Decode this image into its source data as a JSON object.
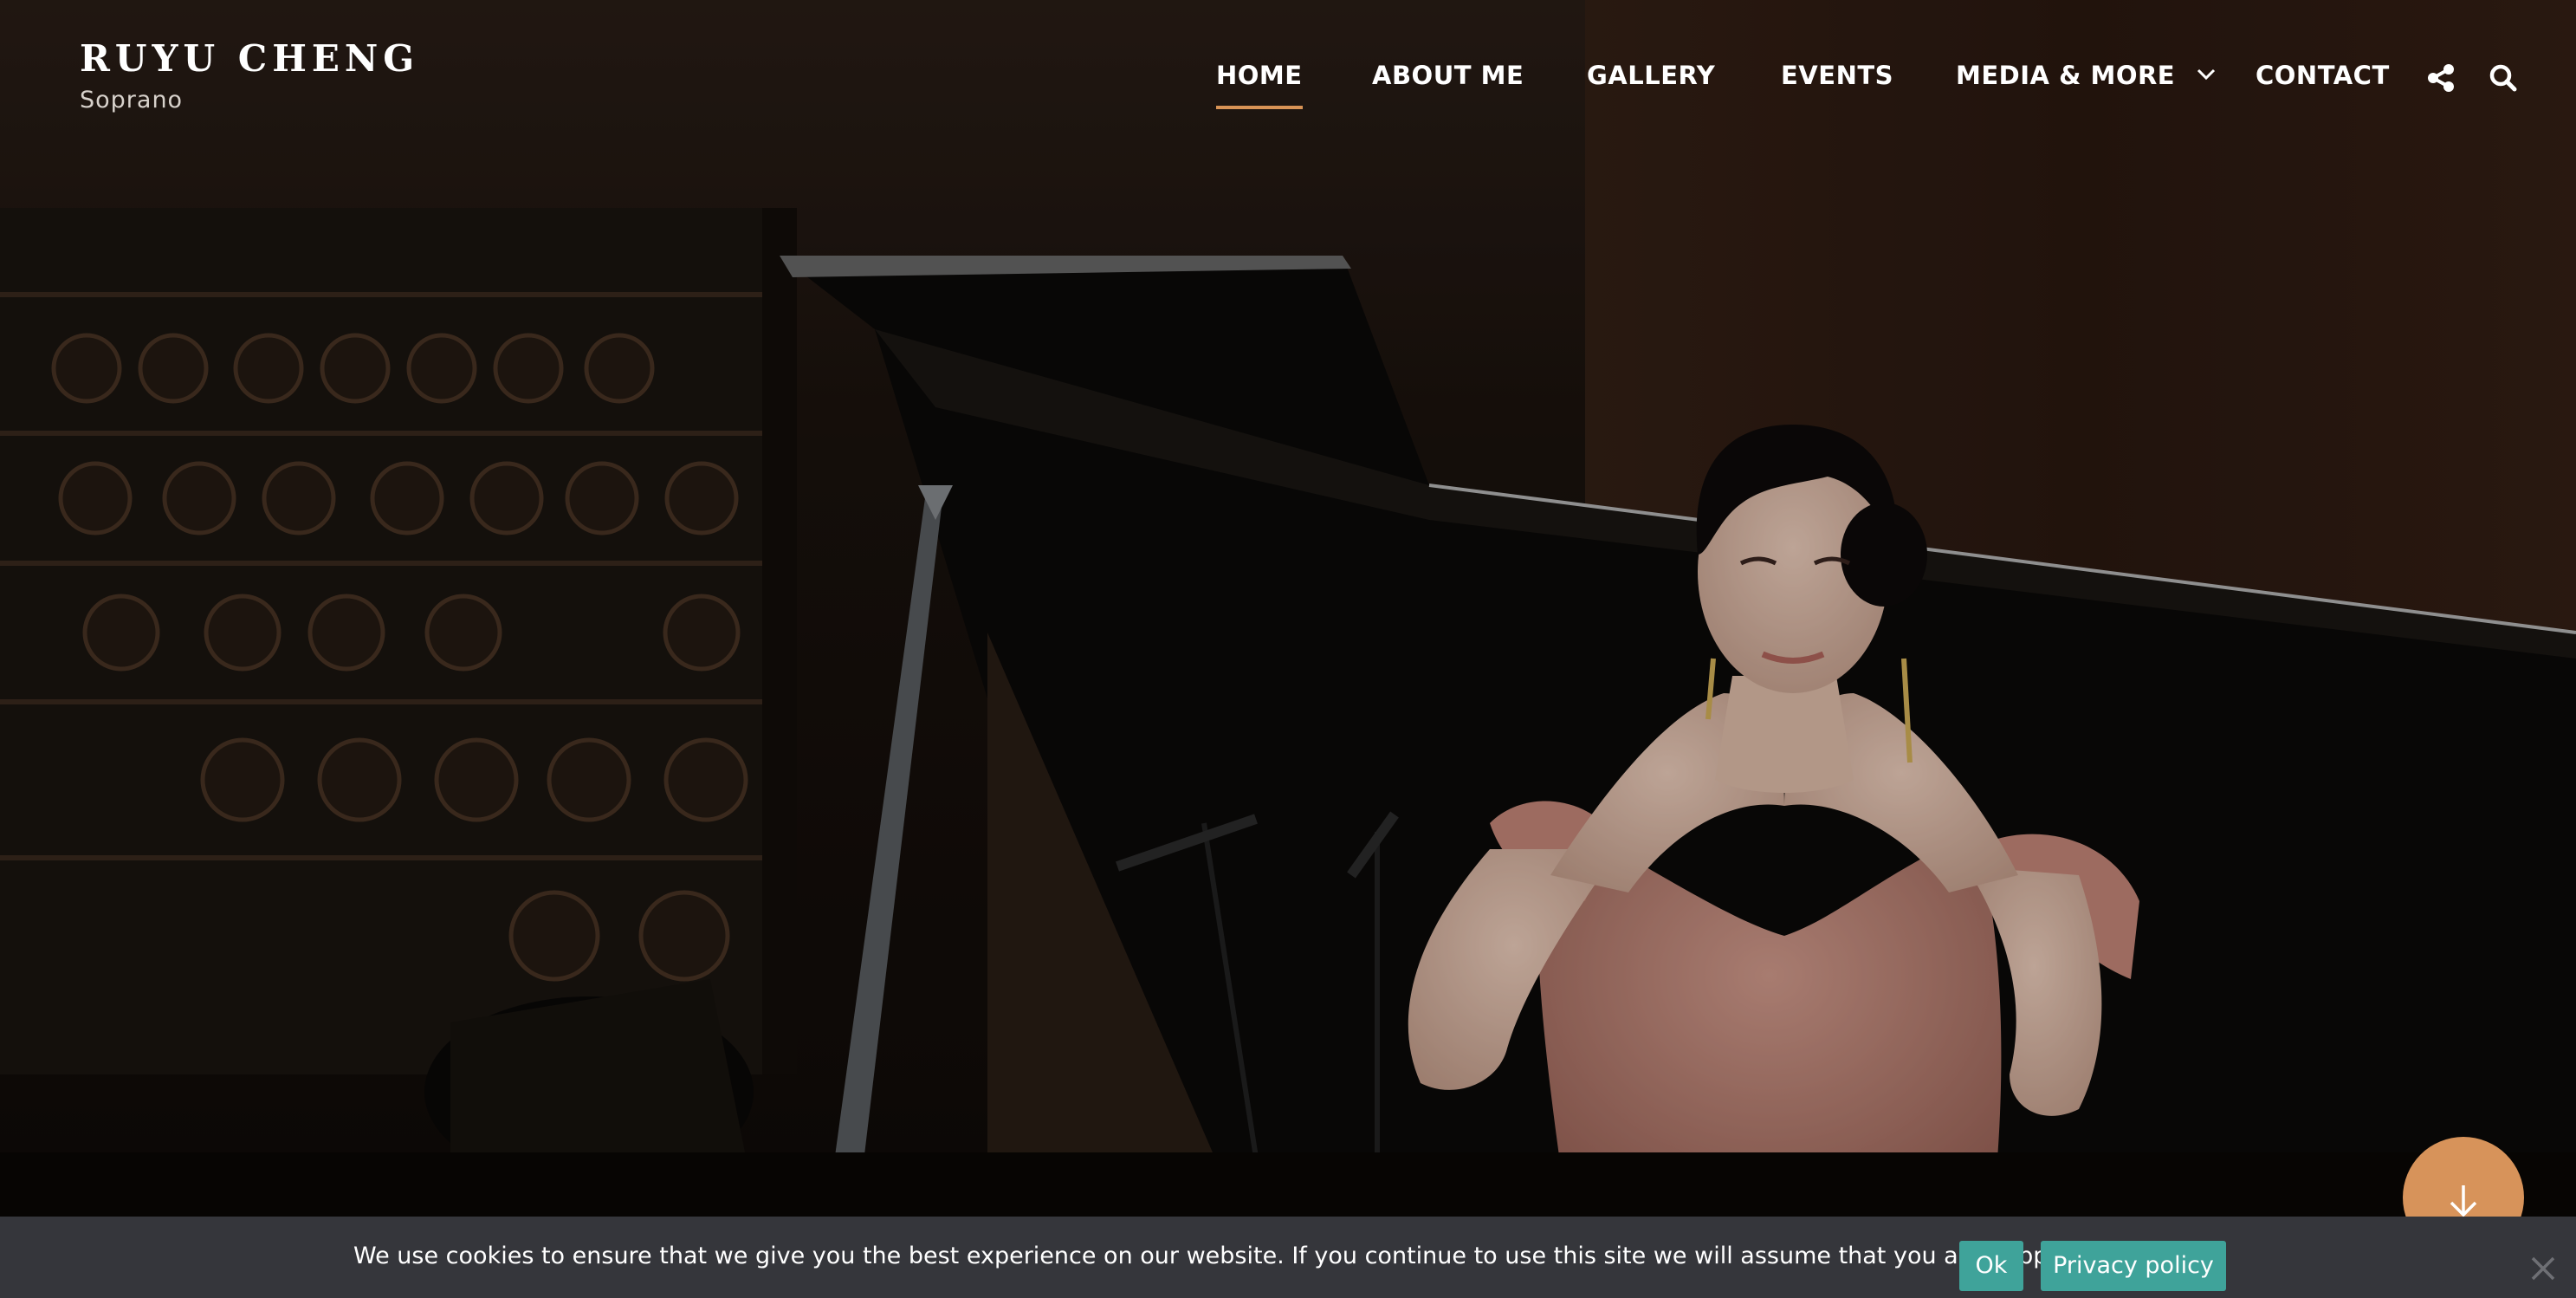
{
  "site": {
    "name": "RUYU CHENG",
    "tagline": "Soprano"
  },
  "nav": {
    "items": [
      {
        "label": "HOME",
        "active": true
      },
      {
        "label": "ABOUT ME",
        "active": false
      },
      {
        "label": "GALLERY",
        "active": false
      },
      {
        "label": "EVENTS",
        "active": false
      },
      {
        "label": "MEDIA & MORE",
        "active": false,
        "has_dropdown": true
      },
      {
        "label": "CONTACT",
        "active": false
      }
    ],
    "icons": [
      "share-icon",
      "search-icon"
    ]
  },
  "hero": {
    "image_alt": "hero-photo"
  },
  "scroll_button": {
    "icon": "arrow-down-icon"
  },
  "cookie_notice": {
    "message": "We use cookies to ensure that we give you the best experience on our website. If you continue to use this site we will assume that you are happy with it.",
    "ok_label": "Ok",
    "privacy_label": "Privacy policy",
    "close_icon": "close-icon"
  },
  "colors": {
    "accent": "#d89355",
    "cookie_bar": "#35363b",
    "cookie_button": "#3fa39a",
    "scroll_button": "#d7935a"
  }
}
